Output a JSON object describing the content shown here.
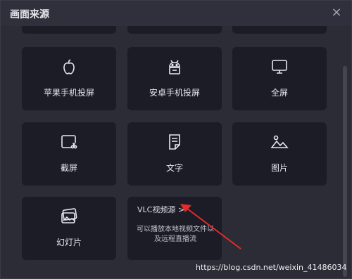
{
  "dialog": {
    "title": "画面来源",
    "close_label": "×"
  },
  "sources": [
    {
      "label": "苹果手机投屏",
      "icon": "apple-icon"
    },
    {
      "label": "安卓手机投屏",
      "icon": "android-icon"
    },
    {
      "label": "全屏",
      "icon": "monitor-icon"
    },
    {
      "label": "截屏",
      "icon": "screenshot-icon"
    },
    {
      "label": "文字",
      "icon": "text-document-icon"
    },
    {
      "label": "图片",
      "icon": "image-icon"
    },
    {
      "label": "幻灯片",
      "icon": "slideshow-icon"
    }
  ],
  "vlc": {
    "title": "VLC视频源 >",
    "desc_line1": "可以播放本地视频文件以",
    "desc_line2": "及远程直播流"
  },
  "watermark": "https://blog.csdn.net/weixin_41486034",
  "colors": {
    "background": "#2b2c36",
    "tile": "#1b1c26",
    "annotation_arrow": "#e52b2b"
  }
}
